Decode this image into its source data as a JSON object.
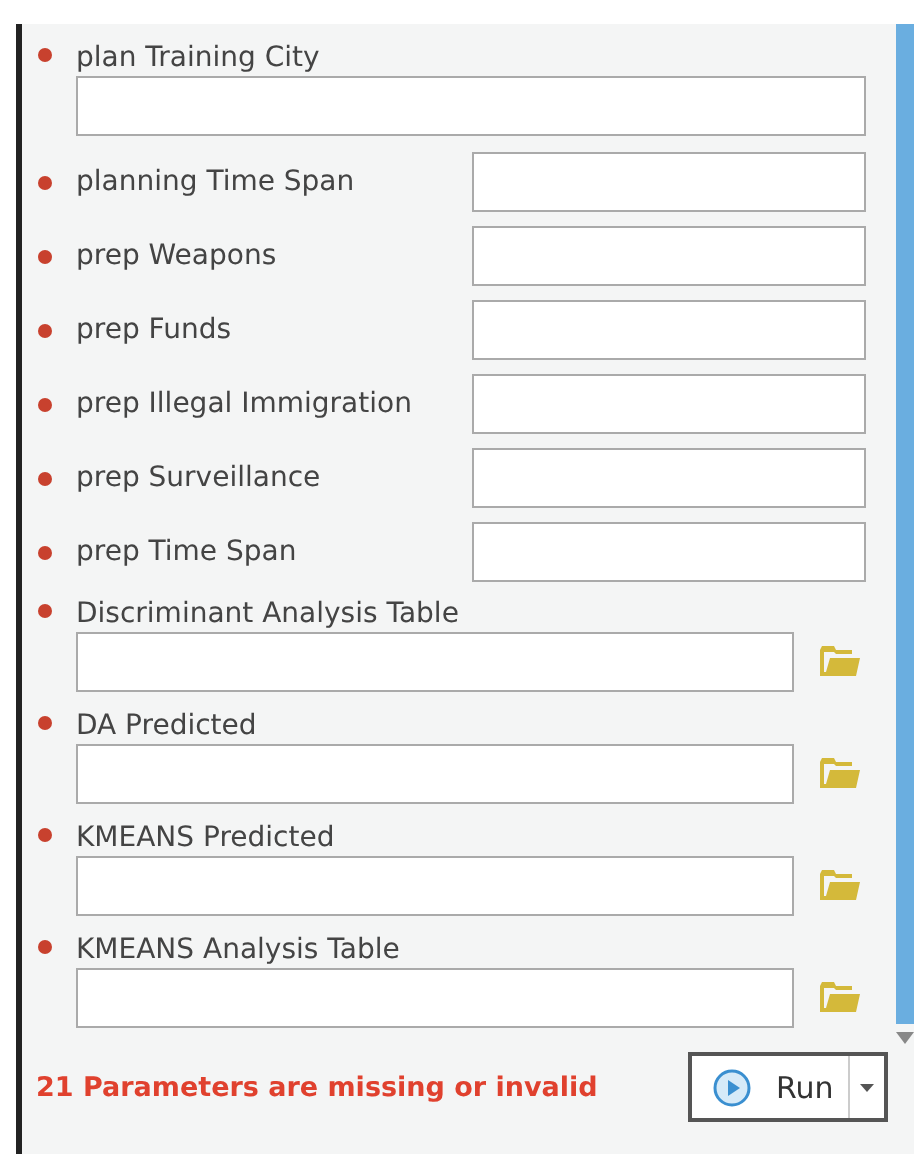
{
  "parameters": [
    {
      "kind": "wide",
      "label": "plan Training City",
      "required": true
    },
    {
      "kind": "inline",
      "label": "planning Time Span",
      "required": true
    },
    {
      "kind": "inline",
      "label": "prep Weapons",
      "required": true
    },
    {
      "kind": "inline",
      "label": "prep Funds",
      "required": true
    },
    {
      "kind": "inline",
      "label": "prep Illegal Immigration",
      "required": true
    },
    {
      "kind": "inline",
      "label": "prep Surveillance",
      "required": true
    },
    {
      "kind": "inline",
      "label": "prep Time Span",
      "required": true
    },
    {
      "kind": "browse",
      "label": "Discriminant Analysis Table",
      "required": true
    },
    {
      "kind": "browse",
      "label": "DA Predicted",
      "required": true
    },
    {
      "kind": "browse",
      "label": "KMEANS Predicted",
      "required": true
    },
    {
      "kind": "browse",
      "label": "KMEANS Analysis Table",
      "required": true
    }
  ],
  "status_message": "21 Parameters are missing or invalid",
  "run_button": {
    "label": "Run"
  }
}
